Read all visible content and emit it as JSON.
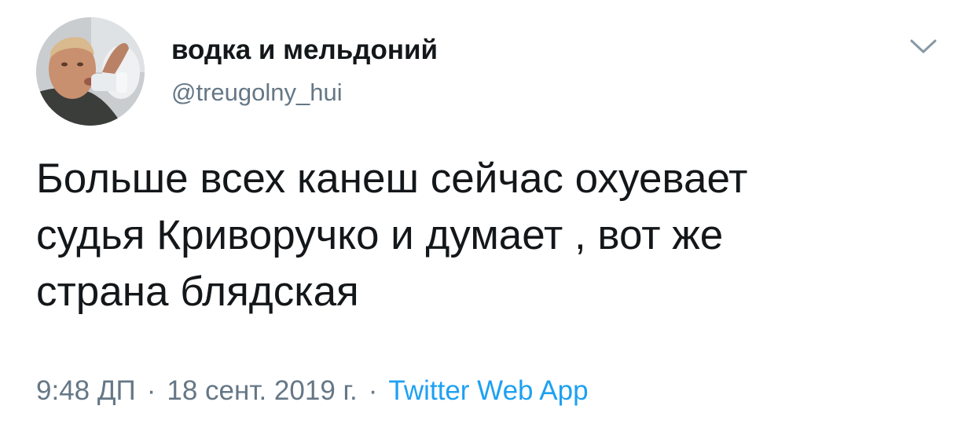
{
  "author": {
    "display_name": "водка и мельдоний",
    "handle": "@treugolny_hui"
  },
  "tweet": {
    "text": "Больше всех канеш сейчас охуевает\nсудья Криворучко и думает , вот же\nстрана блядская"
  },
  "meta": {
    "time": "9:48 ДП",
    "separator": "·",
    "date": "18 сент. 2019 г.",
    "source": "Twitter Web App"
  },
  "icons": {
    "menu": "chevron-down-icon"
  },
  "colors": {
    "text": "#14171a",
    "secondary": "#657786",
    "link": "#1da1f2"
  }
}
